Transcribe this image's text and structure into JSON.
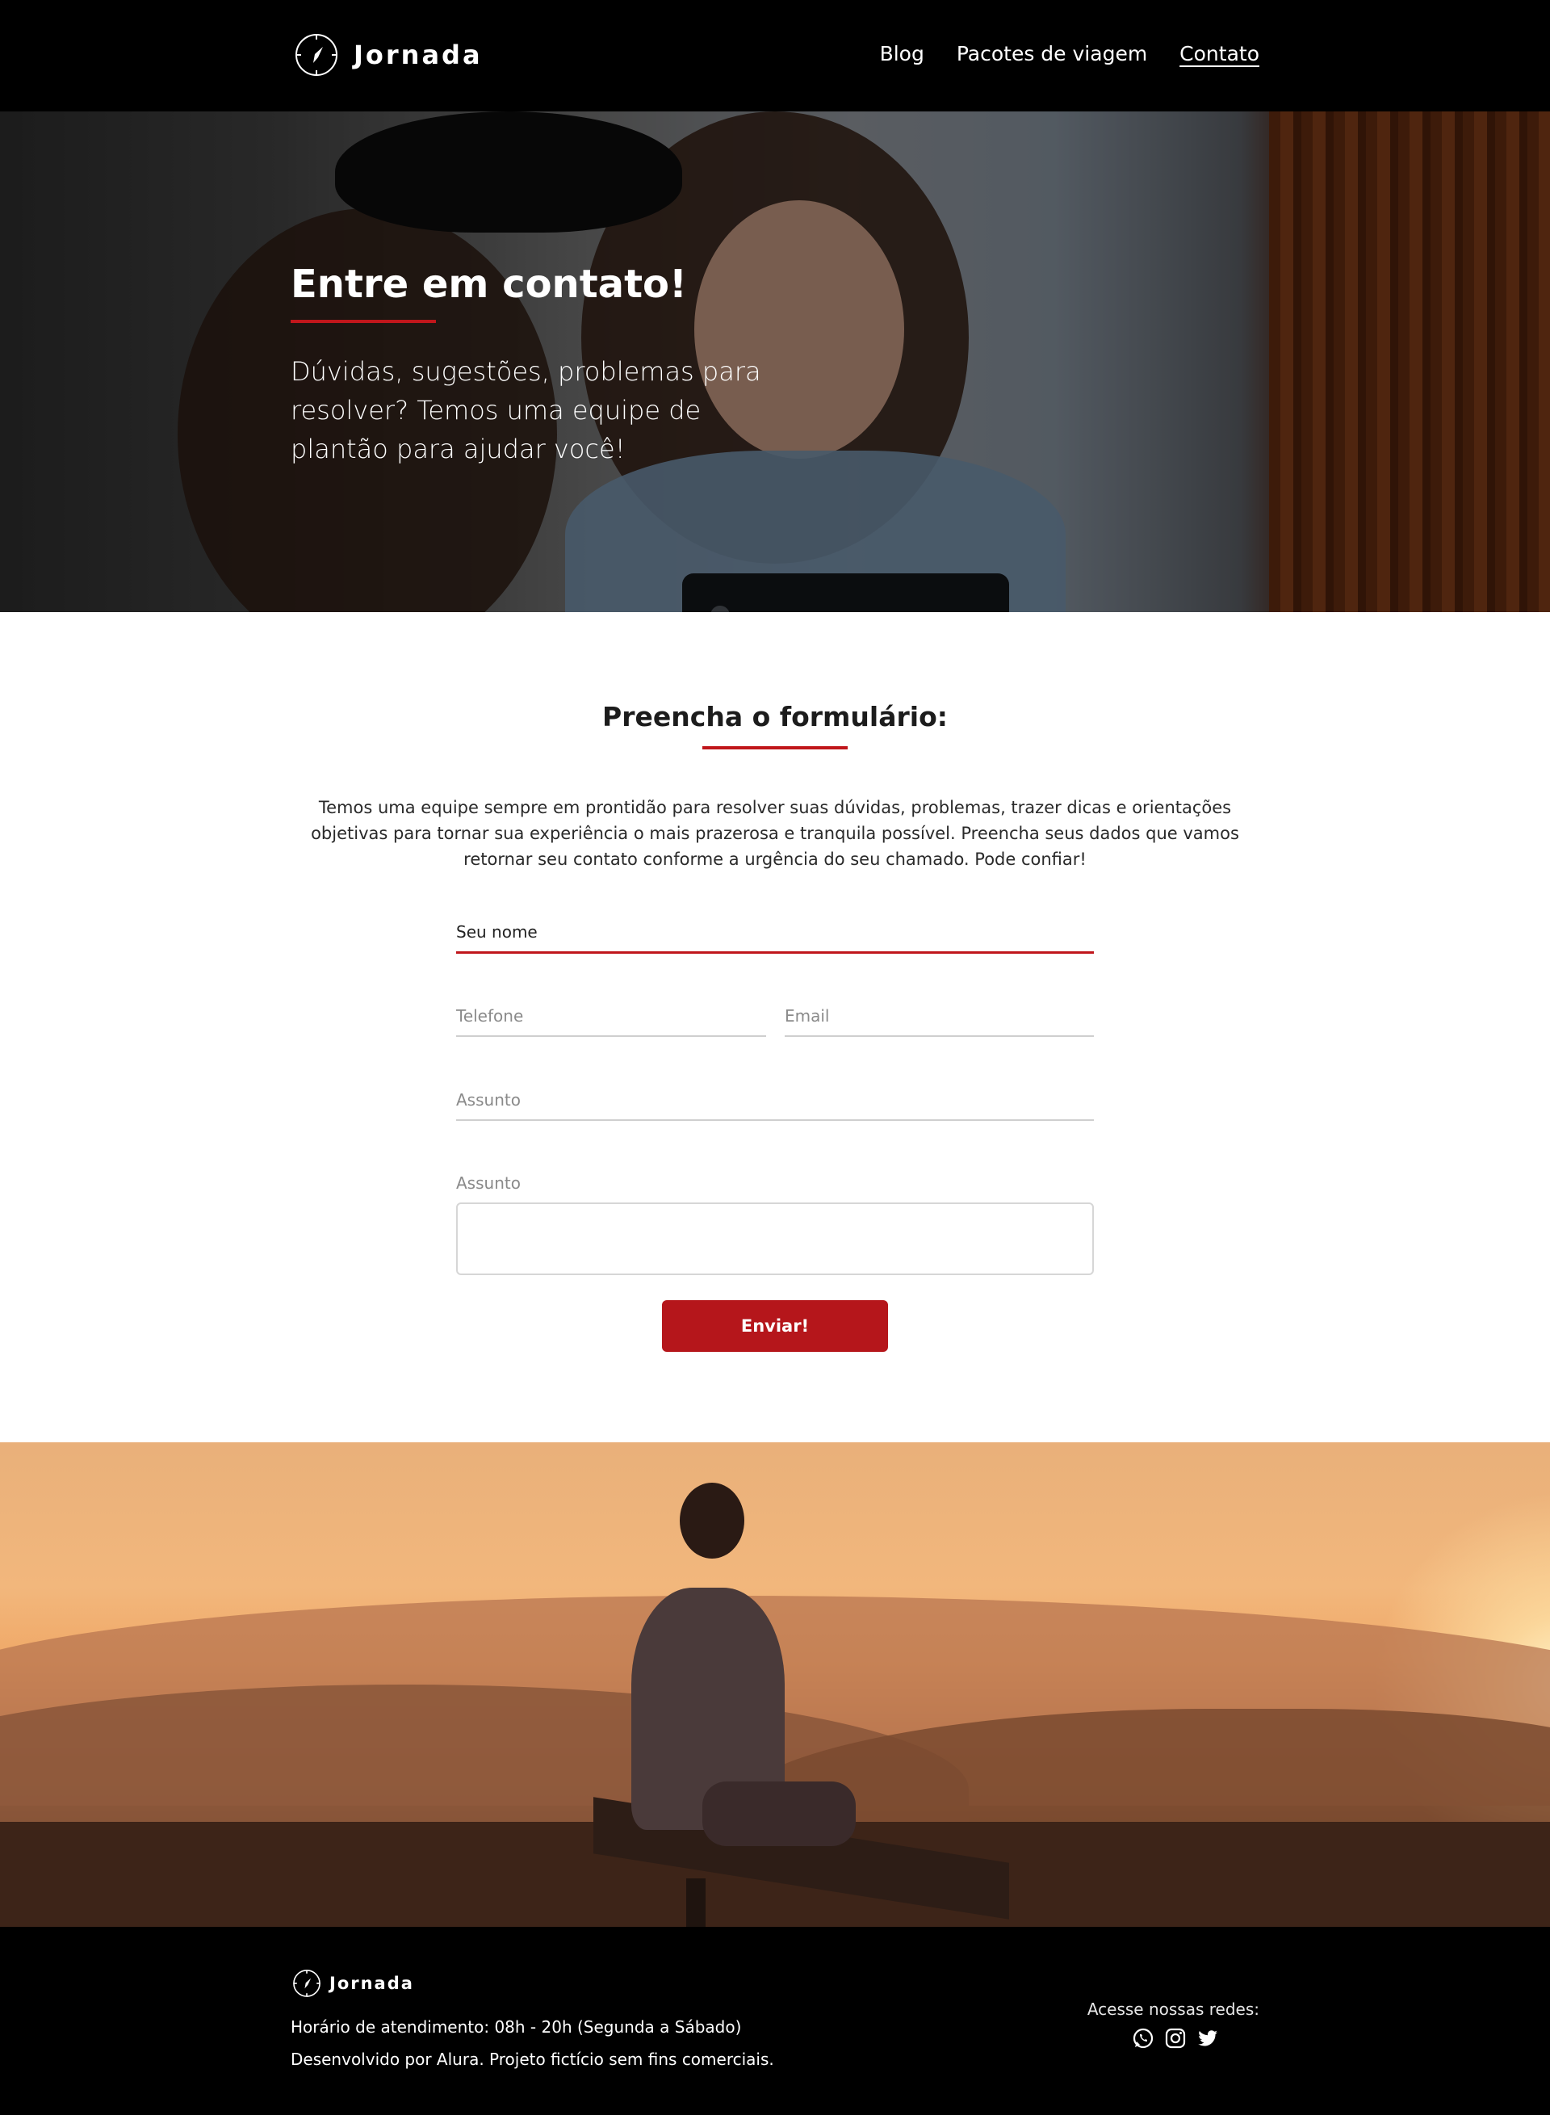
{
  "header": {
    "brand": "Jornada",
    "nav": [
      {
        "label": "Blog"
      },
      {
        "label": "Pacotes de viagem"
      },
      {
        "label": "Contato",
        "active": true
      }
    ]
  },
  "hero": {
    "title": "Entre em contato!",
    "text": "Dúvidas, sugestões, problemas para resolver? Temos uma equipe de plantão para ajudar você!"
  },
  "form": {
    "title": "Preencha o formulário:",
    "description": "Temos uma equipe sempre em prontidão para resolver suas dúvidas, problemas, trazer dicas e orientações objetivas para tornar sua experiência o mais prazerosa e tranquila possível. Preencha seus dados que vamos retornar seu contato conforme a urgência do seu chamado. Pode confiar!",
    "fields": {
      "nome": "Seu nome",
      "telefone": "Telefone",
      "email": "Email",
      "assunto": "Assunto",
      "mensagem": "Assunto"
    },
    "submit": "Enviar!"
  },
  "footer": {
    "brand": "Jornada",
    "hours": "Horário de atendimento: 08h - 20h (Segunda a Sábado)",
    "credits": "Desenvolvido por Alura. Projeto fictício sem fins comerciais.",
    "social_label": "Acesse nossas redes:",
    "social_icons": [
      "whatsapp-icon",
      "instagram-icon",
      "twitter-icon"
    ]
  },
  "colors": {
    "accent": "#c0161b",
    "header_bg": "#000000",
    "footer_bg": "#000000"
  }
}
